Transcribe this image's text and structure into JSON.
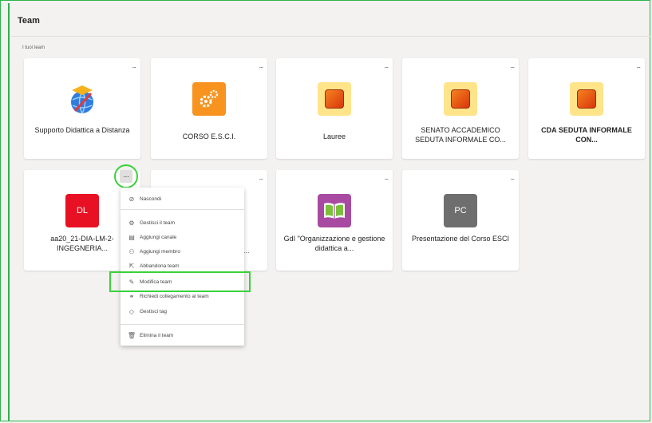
{
  "header": {
    "title": "Team"
  },
  "section": {
    "label": "I tuoi team"
  },
  "more_label": "...",
  "teams_row1": [
    {
      "name": "Supporto Didattica a Distanza",
      "icon": "globe-graduation-icon",
      "bold": false
    },
    {
      "name": "CORSO E.S.C.I.",
      "icon": "gears-icon",
      "bold": false
    },
    {
      "name": "Lauree",
      "icon": "orange-square-icon",
      "bold": false
    },
    {
      "name": "SENATO ACCADEMICO SEDUTA INFORMALE CO...",
      "icon": "orange-square-icon",
      "bold": false
    },
    {
      "name": "CDA SEDUTA INFORMALE CON...",
      "icon": "orange-square-icon",
      "bold": true
    }
  ],
  "teams_row2": [
    {
      "name": "aa20_21-DIA-LM-2-INGEGNERIA...",
      "initials": "DL",
      "color": "#e81123"
    },
    {
      "name": "",
      "initials": "",
      "color": ""
    },
    {
      "name": "GdI \"Organizzazione e gestione didattica a...",
      "icon": "book-icon",
      "color": "#a84aa1"
    },
    {
      "name": "Presentazione del Corso ESCI",
      "initials": "PC",
      "color": "#6e6e6e"
    }
  ],
  "partial_text": "...",
  "menu": {
    "items": [
      {
        "label": "Nascondi",
        "icon": "hide-icon"
      },
      {
        "label": "Gestisci il team",
        "icon": "settings-icon"
      },
      {
        "label": "Aggiungi canale",
        "icon": "channel-icon"
      },
      {
        "label": "Aggiungi membro",
        "icon": "add-member-icon"
      },
      {
        "label": "Abbandona team",
        "icon": "leave-icon"
      },
      {
        "label": "Modifica team",
        "icon": "pencil-icon"
      },
      {
        "label": "Richiedi collegamento al team",
        "icon": "link-icon"
      },
      {
        "label": "Gestisci tag",
        "icon": "tag-icon"
      },
      {
        "label": "Elimina il team",
        "icon": "trash-icon"
      }
    ]
  },
  "colors": {
    "highlight": "#3ad13a",
    "frame": "#2db34a"
  }
}
